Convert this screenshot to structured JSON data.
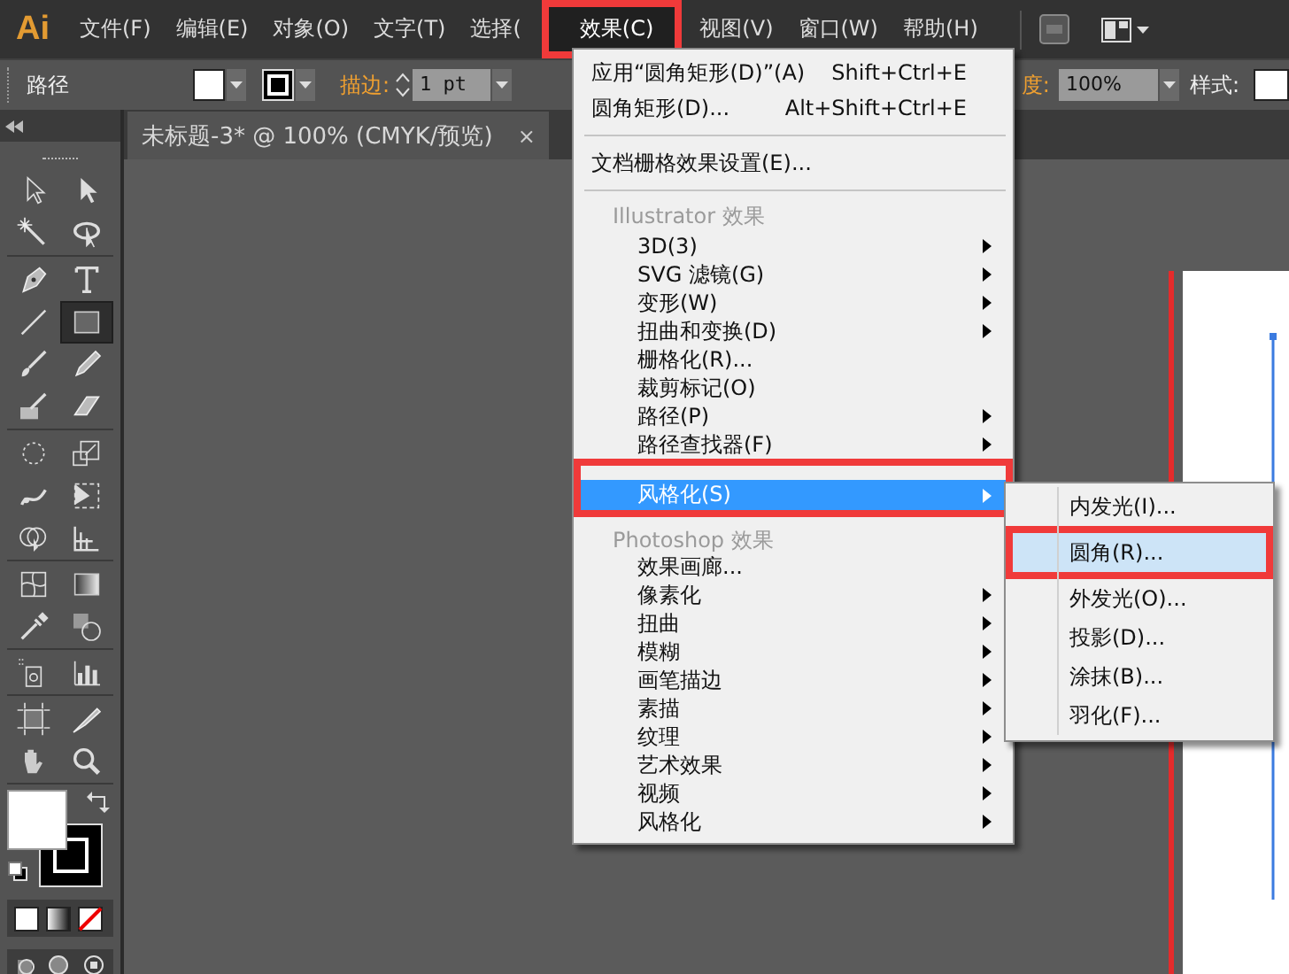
{
  "app": {
    "logo": "Ai"
  },
  "menubar": {
    "items": [
      {
        "label": "文件(F)",
        "selected": false
      },
      {
        "label": "编辑(E)",
        "selected": false
      },
      {
        "label": "对象(O)",
        "selected": false
      },
      {
        "label": "文字(T)",
        "selected": false
      },
      {
        "label": "选择(",
        "selected": false
      },
      {
        "label": "效果(C)",
        "selected": true
      },
      {
        "label": "视图(V)",
        "selected": false
      },
      {
        "label": "窗口(W)",
        "selected": false
      },
      {
        "label": "帮助(H)",
        "selected": false
      }
    ]
  },
  "controlbar": {
    "selection": "路径",
    "stroke_label": "描边:",
    "stroke_weight": "1 pt",
    "opacity_label": "度:",
    "opacity": "100%",
    "style_label": "样式:"
  },
  "document_tab": {
    "title": "未标题-3* @ 100% (CMYK/预览)",
    "close": "×"
  },
  "tools": [
    {
      "kind": "selection",
      "selected": false
    },
    {
      "kind": "direct",
      "selected": false
    },
    {
      "kind": "wand",
      "selected": false
    },
    {
      "kind": "lasso",
      "selected": false
    },
    {
      "kind": "pen",
      "selected": false
    },
    {
      "kind": "type",
      "selected": false
    },
    {
      "kind": "line",
      "selected": false
    },
    {
      "kind": "rectangle",
      "selected": true
    },
    {
      "kind": "brush",
      "selected": false
    },
    {
      "kind": "pencil",
      "selected": false
    },
    {
      "kind": "blob",
      "selected": false
    },
    {
      "kind": "eraser",
      "selected": false
    },
    {
      "kind": "rotate",
      "selected": false
    },
    {
      "kind": "scale",
      "selected": false
    },
    {
      "kind": "warp",
      "selected": false
    },
    {
      "kind": "transform",
      "selected": false
    },
    {
      "kind": "builder",
      "selected": false
    },
    {
      "kind": "grid",
      "selected": false
    },
    {
      "kind": "mesh",
      "selected": false
    },
    {
      "kind": "gradient",
      "selected": false
    },
    {
      "kind": "eyedropper",
      "selected": false
    },
    {
      "kind": "blend",
      "selected": false
    },
    {
      "kind": "sprayer",
      "selected": false
    },
    {
      "kind": "graph",
      "selected": false
    },
    {
      "kind": "artboard",
      "selected": false
    },
    {
      "kind": "slice",
      "selected": false
    },
    {
      "kind": "hand",
      "selected": false
    },
    {
      "kind": "zoom",
      "selected": false
    }
  ],
  "effect_menu": {
    "items": [
      {
        "kind": "command",
        "label": "应用“圆角矩形(D)”(A)",
        "shortcut": "Shift+Ctrl+E",
        "selected": false
      },
      {
        "kind": "command",
        "label": "圆角矩形(D)...",
        "shortcut": "Alt+Shift+Ctrl+E",
        "selected": false
      },
      {
        "kind": "separator"
      },
      {
        "kind": "command",
        "label": "文档栅格效果设置(E)...",
        "selected": false
      },
      {
        "kind": "separator"
      },
      {
        "kind": "header",
        "label": "Illustrator 效果"
      },
      {
        "kind": "submenu",
        "label": "3D(3)",
        "selected": false
      },
      {
        "kind": "submenu",
        "label": "SVG 滤镜(G)",
        "selected": false
      },
      {
        "kind": "submenu",
        "label": "变形(W)",
        "selected": false
      },
      {
        "kind": "submenu",
        "label": "扭曲和变换(D)",
        "selected": false
      },
      {
        "kind": "entry",
        "label": "栅格化(R)...",
        "selected": false
      },
      {
        "kind": "entry",
        "label": "裁剪标记(O)",
        "selected": false
      },
      {
        "kind": "submenu",
        "label": "路径(P)",
        "selected": false
      },
      {
        "kind": "submenu",
        "label": "路径查找器(F)",
        "selected": false
      },
      {
        "kind": "submenu",
        "label": "风格化(S)",
        "selected": true
      },
      {
        "kind": "header",
        "label": "Photoshop 效果"
      },
      {
        "kind": "entry",
        "label": "效果画廊...",
        "selected": false
      },
      {
        "kind": "submenu",
        "label": "像素化",
        "selected": false
      },
      {
        "kind": "submenu",
        "label": "扭曲",
        "selected": false
      },
      {
        "kind": "submenu",
        "label": "模糊",
        "selected": false
      },
      {
        "kind": "submenu",
        "label": "画笔描边",
        "selected": false
      },
      {
        "kind": "submenu",
        "label": "素描",
        "selected": false
      },
      {
        "kind": "submenu",
        "label": "纹理",
        "selected": false
      },
      {
        "kind": "submenu",
        "label": "艺术效果",
        "selected": false
      },
      {
        "kind": "submenu",
        "label": "视频",
        "selected": false
      },
      {
        "kind": "submenu",
        "label": "风格化",
        "selected": false
      }
    ]
  },
  "stylize_submenu": {
    "items": [
      {
        "label": "内发光(I)...",
        "selected": false
      },
      {
        "label": "圆角(R)...",
        "selected": true
      },
      {
        "label": "外发光(O)...",
        "selected": false
      },
      {
        "label": "投影(D)...",
        "selected": false
      },
      {
        "label": "涂抹(B)...",
        "selected": false
      },
      {
        "label": "羽化(F)...",
        "selected": false
      }
    ]
  }
}
